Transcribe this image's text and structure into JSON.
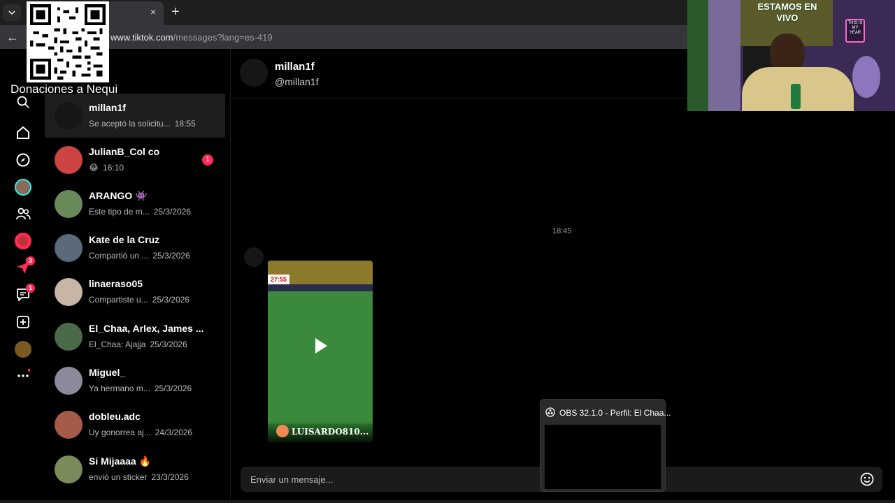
{
  "browser": {
    "url_host": "www.tiktok.com",
    "url_path": "/messages?lang=es-419"
  },
  "overlay": {
    "qr_caption": "Donaciones a Nequi"
  },
  "rail": {
    "explore_badge": "3",
    "messages_badge": "1"
  },
  "conversations": [
    {
      "name": "millan1f",
      "preview": "Se aceptó la solicitu...",
      "time": "18:55"
    },
    {
      "name": "JulianB_Col co",
      "preview": "😂",
      "time": "16:10",
      "unread": "1"
    },
    {
      "name": "ARANGO 👾",
      "preview": "Este tipo de m...",
      "time": "25/3/2026"
    },
    {
      "name": "Kate de la Cruz",
      "preview": "Compartió un ...",
      "time": "25/3/2026"
    },
    {
      "name": "linaeraso05",
      "preview": "Compartiste u...",
      "time": "25/3/2026"
    },
    {
      "name": "El_Chaa, Arlex, James ...",
      "preview": "El_Chaa: Ajajja",
      "time": "25/3/2026"
    },
    {
      "name": "Miguel_",
      "preview": "Ya hermano m...",
      "time": "25/3/2026"
    },
    {
      "name": "dobleu.adc",
      "preview": "Uy gonorrea aj...",
      "time": "24/3/2026"
    },
    {
      "name": "Si Mijaaaa 🔥",
      "preview": "envió un sticker",
      "time": "23/3/2026"
    }
  ],
  "chat": {
    "name": "millan1f",
    "handle": "@millan1f",
    "message_time": "18:45",
    "video_timer": "27:55",
    "video_caption": "LUISARDO810...",
    "composer_placeholder": "Enviar un mensaje..."
  },
  "obs_popup": {
    "title": "OBS 32.1.0 - Perfil: El Chaa..."
  },
  "webcam": {
    "sign_text": "ESTAMOS EN VIVO",
    "neon_text": "THIS IS MY YEAR"
  },
  "colors": {
    "accent": "#fe2c55",
    "background": "#000000",
    "active_row": "#1e1e1e"
  }
}
